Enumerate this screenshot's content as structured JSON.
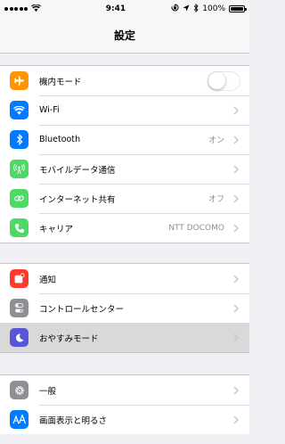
{
  "status_bar": {
    "carrier_signal_icon": "signal-dots-icon",
    "wifi_icon": "wifi-icon",
    "time": "9:41",
    "battery_percent": "100%"
  },
  "nav": {
    "title": "設定"
  },
  "groups": [
    {
      "rows": [
        {
          "label": "機内モード",
          "icon": "airplane-icon",
          "color": "#ff9500",
          "control": "toggle",
          "value": false
        },
        {
          "label": "Wi-Fi",
          "icon": "wifi-icon",
          "color": "#007aff",
          "detail": ""
        },
        {
          "label": "Bluetooth",
          "icon": "bluetooth-icon",
          "color": "#007aff",
          "detail": "オン"
        },
        {
          "label": "モバイルデータ通信",
          "icon": "antenna-icon",
          "color": "#4cd964",
          "detail": ""
        },
        {
          "label": "インターネット共有",
          "icon": "link-icon",
          "color": "#4cd964",
          "detail": "オフ"
        },
        {
          "label": "キャリア",
          "icon": "phone-icon",
          "color": "#4cd964",
          "detail": "NTT DOCOMO"
        }
      ]
    },
    {
      "rows": [
        {
          "label": "通知",
          "icon": "notification-icon",
          "color": "#ff3b30",
          "detail": ""
        },
        {
          "label": "コントロールセンター",
          "icon": "control-center-icon",
          "color": "#8e8e93",
          "detail": ""
        },
        {
          "label": "おやすみモード",
          "icon": "moon-icon",
          "color": "#5856d6",
          "detail": "",
          "highlighted": true
        }
      ]
    },
    {
      "rows": [
        {
          "label": "一般",
          "icon": "gear-icon",
          "color": "#8e8e93",
          "detail": ""
        },
        {
          "label": "画面表示と明るさ",
          "icon": "text-size-icon",
          "color": "#007aff",
          "detail": ""
        }
      ]
    }
  ]
}
